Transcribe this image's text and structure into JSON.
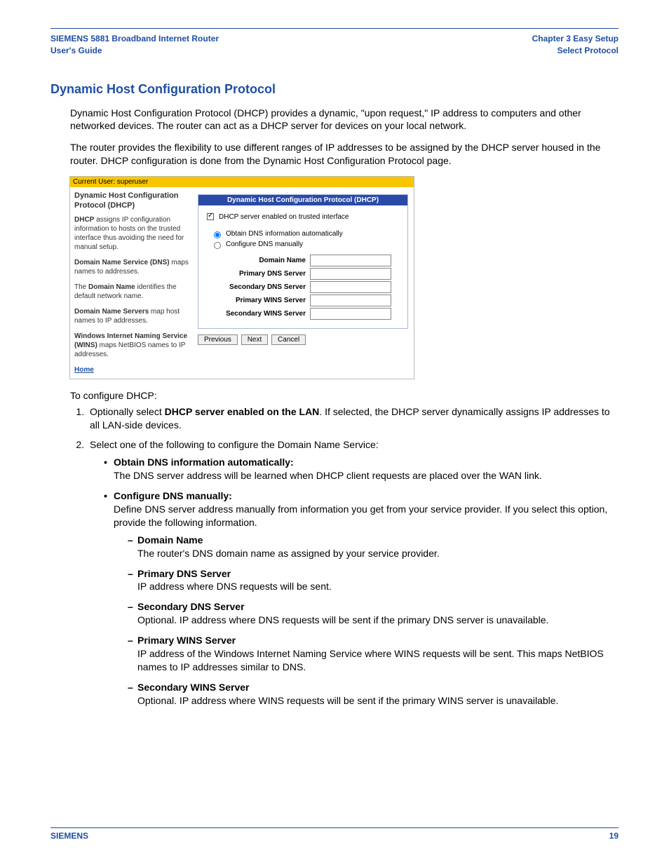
{
  "header": {
    "left_line1": "SIEMENS 5881 Broadband Internet Router",
    "left_line2": "User's Guide",
    "right_line1": "Chapter 3  Easy Setup",
    "right_line2": "Select Protocol"
  },
  "section": {
    "title": "Dynamic Host Configuration Protocol",
    "para1": "Dynamic Host Configuration Protocol (DHCP) provides a dynamic, \"upon request,\" IP address to computers and other networked devices. The router can act as a DHCP server for devices on your local network.",
    "para2": "The router provides the flexibility to use different ranges of IP addresses to be assigned by the DHCP server housed in the router. DHCP configuration is done from the Dynamic Host Configuration Protocol page."
  },
  "screenshot": {
    "userbar": "Current User: superuser",
    "left_title": "Dynamic Host Configuration Protocol (DHCP)",
    "left_p1_b": "DHCP",
    "left_p1_rest": " assigns IP configuration information to hosts on the trusted interface thus avoiding the need for manual setup.",
    "left_p2_b": "Domain Name Service (DNS)",
    "left_p2_rest": " maps names to addresses.",
    "left_p3_pre": "The ",
    "left_p3_b": "Domain Name",
    "left_p3_rest": " identifies the default network name.",
    "left_p4_b": "Domain Name Servers",
    "left_p4_rest": " map host names to IP addresses.",
    "left_p5_b": "Windows Internet Naming Service (WINS)",
    "left_p5_rest": " maps NetBIOS names to IP addresses.",
    "home": "Home",
    "panel_title": "Dynamic Host Configuration Protocol (DHCP)",
    "check_label": "DHCP server enabled on trusted interface",
    "radio1": "Obtain DNS information automatically",
    "radio2": "Configure DNS manually",
    "fields": {
      "f1": "Domain Name",
      "f2": "Primary DNS Server",
      "f3": "Secondary DNS Server",
      "f4": "Primary WINS Server",
      "f5": "Secondary WINS Server"
    },
    "btn_prev": "Previous",
    "btn_next": "Next",
    "btn_cancel": "Cancel"
  },
  "instructions": {
    "intro": "To configure DHCP:",
    "step1_pre": "Optionally select ",
    "step1_b": "DHCP server enabled on the LAN",
    "step1_post": ". If selected, the DHCP server dynamically assigns IP addresses to all LAN-side devices.",
    "step2": "Select one of the following to configure the Domain Name Service:",
    "b1_title": "Obtain DNS information automatically:",
    "b1_body": "The DNS server address will be learned when DHCP client requests are placed over the WAN link.",
    "b2_title": "Configure DNS manually:",
    "b2_body": "Define DNS server address manually from information you get from your service provider. If you select this option, provide the following information.",
    "d1_t": "Domain Name",
    "d1_b": "The router's DNS domain name as assigned by your service provider.",
    "d2_t": "Primary DNS Server",
    "d2_b": "IP address where DNS requests will be sent.",
    "d3_t": "Secondary DNS Server",
    "d3_b": "Optional. IP address where DNS requests will be sent if the primary DNS server is unavailable.",
    "d4_t": "Primary WINS Server",
    "d4_b": "IP address of the Windows Internet Naming Service where WINS requests will be sent. This maps NetBIOS names to IP addresses similar to DNS.",
    "d5_t": "Secondary WINS Server",
    "d5_b": "Optional. IP address where WINS requests will be sent if the primary WINS server is unavailable."
  },
  "footer": {
    "brand": "SIEMENS",
    "page": "19"
  }
}
